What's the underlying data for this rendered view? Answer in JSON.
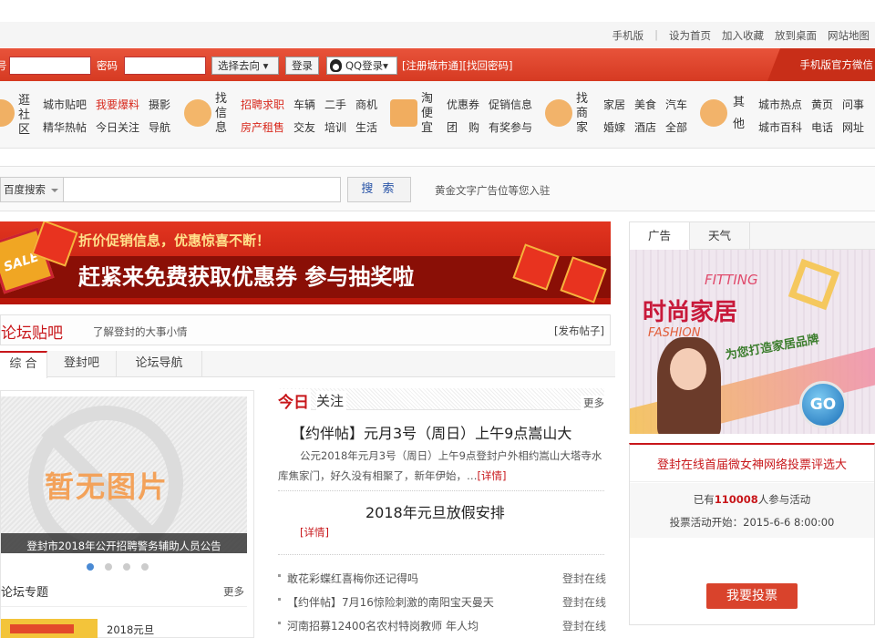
{
  "topbar": {
    "links": [
      "手机版",
      "设为首页",
      "加入收藏",
      "放到桌面",
      "网站地图"
    ]
  },
  "login": {
    "user_label": "号",
    "password_label": "密码",
    "destination": "选择去向",
    "login_button": "登录",
    "qq_login": "QQ登录",
    "register": "[注册城市通]",
    "retrieve": "[找回密码]",
    "mobile_official": "手机版官方微信"
  },
  "categories": [
    {
      "title": "逛社区",
      "items": [
        [
          "城市贴吧",
          "我要爆料",
          "摄影"
        ],
        [
          "精华热帖",
          "今日关注",
          "导航"
        ]
      ],
      "red": [
        "我要爆料"
      ]
    },
    {
      "title": "找信息",
      "items": [
        [
          "招聘求职",
          "车辆",
          "二手",
          "商机"
        ],
        [
          "房产租售",
          "交友",
          "培训",
          "生活"
        ]
      ],
      "red": [
        "招聘求职",
        "房产租售"
      ]
    },
    {
      "title": "淘便宜",
      "items": [
        [
          "优惠券",
          "促销信息"
        ],
        [
          "团　购",
          "有奖参与"
        ]
      ],
      "red": []
    },
    {
      "title": "找商家",
      "items": [
        [
          "家居",
          "美食",
          "汽车"
        ],
        [
          "婚嫁",
          "酒店",
          "全部"
        ]
      ],
      "red": []
    },
    {
      "title": "其他",
      "items": [
        [
          "城市热点",
          "黄页",
          "问事"
        ],
        [
          "城市百科",
          "电话",
          "网址"
        ]
      ],
      "red": []
    }
  ],
  "search": {
    "engine": "百度搜索",
    "button": "搜 索",
    "ad_text": "黄金文字广告位等您入驻"
  },
  "banner": {
    "line1": "折价促销信息，优惠惊喜不断！",
    "line2": "赶紧来免费获取优惠券 参与抽奖啦",
    "sale_tag": "SALE"
  },
  "forum": {
    "title": "论坛贴吧",
    "subtitle": "了解登封的大事小情",
    "post_link": "[发布帖子]",
    "tabs": [
      "综 合",
      "登封吧",
      "论坛导航"
    ]
  },
  "slideshow": {
    "placeholder": "暂无图片",
    "caption": "登封市2018年公开招聘警务辅助人员公告",
    "dots": 4,
    "active_dot": 0,
    "topic_title": "论坛专题",
    "topic_more": "更多",
    "topic_item": "2018元旦"
  },
  "focus": {
    "title_red": "今日",
    "title_black": "关注",
    "more": "更多",
    "headline": "【约伴帖】元月3号（周日）上午9点嵩山大",
    "summary": "公元2018年元月3号（周日）上午9点登封户外相约嵩山大塔寺水库焦家门，好久没有相聚了，新年伊始，…",
    "detail": "[详情]",
    "headline2": "2018年元旦放假安排",
    "detail2": "[详情]",
    "list": [
      {
        "text": "敢花彩蝶红喜梅你还记得吗",
        "source": "登封在线"
      },
      {
        "text": "【约伴帖】7月16惊险刺激的南阳宝天曼天",
        "source": "登封在线"
      },
      {
        "text": "河南招募12400名农村特岗教师 年人均",
        "source": "登封在线"
      }
    ]
  },
  "right": {
    "tabs": [
      "广告",
      "天气"
    ],
    "ad_title": "时尚家居",
    "ad_fitting": "FITTING",
    "ad_fashion": "FASHION",
    "ad_slogan": "为您打造家居品牌",
    "ad_go": "GO",
    "vote_title": "登封在线首届微女神网络投票评选大",
    "vote_count_prefix": "已有",
    "vote_count": "110008",
    "vote_count_suffix": "人参与活动",
    "vote_start": "投票活动开始：2015-6-6 8:00:00",
    "vote_button": "我要投票"
  }
}
